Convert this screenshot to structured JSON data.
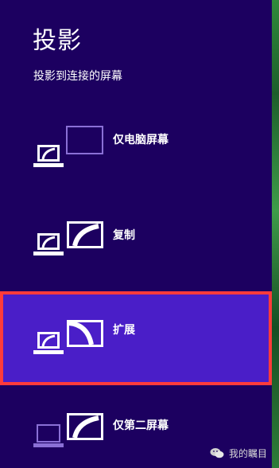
{
  "title": "投影",
  "subtitle": "投影到连接的屏幕",
  "options": [
    {
      "label": "仅电脑屏幕"
    },
    {
      "label": "复制"
    },
    {
      "label": "扩展"
    },
    {
      "label": "仅第二屏幕"
    }
  ],
  "watermark": "我的瞩目"
}
